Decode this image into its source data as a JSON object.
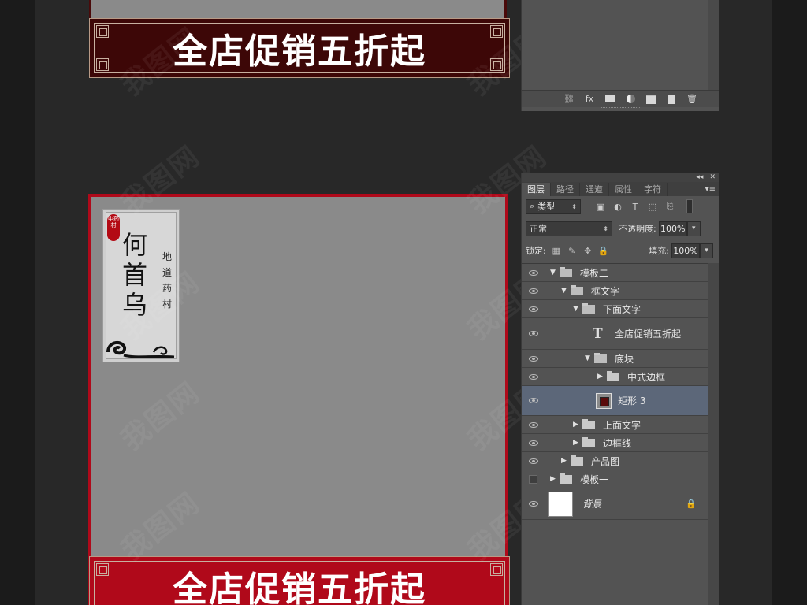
{
  "canvas": {
    "banner_top_text": "全店促销五折起",
    "banner_bottom_text": "全店促销五折起",
    "label": {
      "seal": "中药村",
      "title": "何首乌",
      "subtitle": "地道药村"
    },
    "watermark": "我图网"
  },
  "top_panel": {
    "footer_icons": [
      "link-icon",
      "fx-icon",
      "mask-icon",
      "adjustment-icon",
      "folder-icon",
      "new-layer-icon",
      "trash-icon"
    ],
    "fx_label": "fx"
  },
  "layers_panel": {
    "titlebar_collapse": "◂◂",
    "titlebar_close": "✕",
    "tabs": [
      {
        "label": "图层",
        "active": true
      },
      {
        "label": "路径",
        "active": false
      },
      {
        "label": "通道",
        "active": false
      },
      {
        "label": "属性",
        "active": false
      },
      {
        "label": "字符",
        "active": false
      }
    ],
    "filter_kind": "类型",
    "blend_mode": "正常",
    "opacity_label": "不透明度:",
    "opacity_value": "100%",
    "lock_label": "锁定:",
    "fill_label": "填充:",
    "fill_value": "100%",
    "layers": [
      {
        "name": "模板二",
        "type": "group",
        "open": true,
        "depth": 0,
        "visible": true
      },
      {
        "name": "框文字",
        "type": "group",
        "open": true,
        "depth": 1,
        "visible": true
      },
      {
        "name": "下面文字",
        "type": "group",
        "open": true,
        "depth": 2,
        "visible": true
      },
      {
        "name": "全店促销五折起",
        "type": "text",
        "depth": 3,
        "visible": true
      },
      {
        "name": "底块",
        "type": "group",
        "open": true,
        "depth": 3,
        "visible": true
      },
      {
        "name": "中式边框",
        "type": "group",
        "open": false,
        "depth": 4,
        "visible": true
      },
      {
        "name": "矩形 3",
        "type": "shape",
        "depth": 4,
        "visible": true,
        "selected": true
      },
      {
        "name": "上面文字",
        "type": "group",
        "open": false,
        "depth": 2,
        "visible": true
      },
      {
        "name": "边框线",
        "type": "group",
        "open": false,
        "depth": 2,
        "visible": true
      },
      {
        "name": "产品图",
        "type": "group",
        "open": false,
        "depth": 1,
        "visible": true
      },
      {
        "name": "模板一",
        "type": "group",
        "open": false,
        "depth": 0,
        "visible": false
      },
      {
        "name": "背景",
        "type": "background",
        "depth": 0,
        "visible": true,
        "locked": true
      }
    ]
  }
}
